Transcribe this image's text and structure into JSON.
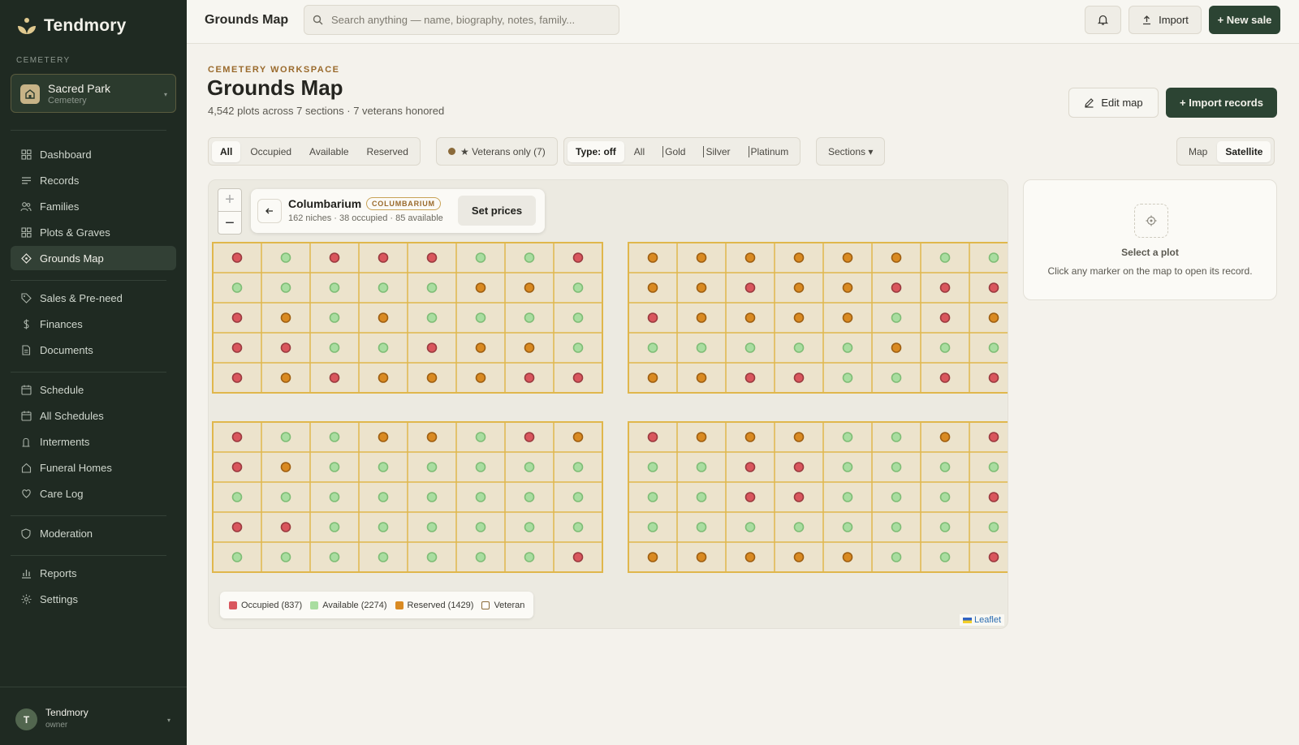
{
  "brand": {
    "name": "Tendmory"
  },
  "sidebar": {
    "section_label": "CEMETERY",
    "cemetery": {
      "name": "Sacred Park",
      "type": "Cemetery"
    },
    "groups": [
      [
        {
          "label": "Dashboard",
          "icon": "grid-icon"
        },
        {
          "label": "Records",
          "icon": "list-icon"
        },
        {
          "label": "Families",
          "icon": "users-icon"
        },
        {
          "label": "Plots & Graves",
          "icon": "grid-icon"
        },
        {
          "label": "Grounds Map",
          "icon": "diamond-icon",
          "active": true
        }
      ],
      [
        {
          "label": "Sales & Pre-need",
          "icon": "tag-icon"
        },
        {
          "label": "Finances",
          "icon": "dollar-icon"
        },
        {
          "label": "Documents",
          "icon": "document-icon"
        }
      ],
      [
        {
          "label": "Schedule",
          "icon": "calendar-icon"
        },
        {
          "label": "All Schedules",
          "icon": "calendar-icon"
        },
        {
          "label": "Interments",
          "icon": "headstone-icon"
        },
        {
          "label": "Funeral Homes",
          "icon": "home-icon"
        },
        {
          "label": "Care Log",
          "icon": "heart-icon"
        }
      ],
      [
        {
          "label": "Moderation",
          "icon": "shield-icon"
        }
      ],
      [
        {
          "label": "Reports",
          "icon": "bar-chart-icon"
        },
        {
          "label": "Settings",
          "icon": "gear-icon"
        }
      ]
    ],
    "user": {
      "initial": "T",
      "name": "Tendmory",
      "role": "owner"
    }
  },
  "topbar": {
    "title": "Grounds Map",
    "search_placeholder": "Search anything — name, biography, notes, family...",
    "import_label": "Import",
    "new_sale_label": "+ New sale"
  },
  "header": {
    "eyebrow": "CEMETERY WORKSPACE",
    "title": "Grounds Map",
    "subtitle": "4,542 plots across 7 sections · 7 veterans honored",
    "edit_map_label": "Edit map",
    "import_records_label": "+ Import records"
  },
  "filters": {
    "status": [
      "All",
      "Occupied",
      "Available",
      "Reserved"
    ],
    "status_selected": "All",
    "veterans_label": "★ Veterans only (7)",
    "type_label": "Type: off",
    "type_options": [
      "All",
      "Gold",
      "Silver",
      "Platinum"
    ],
    "sections_label": "Sections ▾",
    "view": [
      "Map",
      "Satellite"
    ],
    "view_selected": "Satellite"
  },
  "map": {
    "section": {
      "name": "Columbarium",
      "badge": "COLUMBARIUM",
      "meta": "162 niches · 38 occupied · 85 available",
      "set_prices_label": "Set prices"
    },
    "zoom_in": "+",
    "zoom_out": "−",
    "attribution": "Leaflet",
    "legend": [
      {
        "label": "Occupied (837)",
        "color": "#d9565d"
      },
      {
        "label": "Available (2274)",
        "color": "#a9dda0"
      },
      {
        "label": "Reserved (1429)",
        "color": "#d98a22"
      },
      {
        "label": "Veteran",
        "color": "#ffffff"
      }
    ],
    "status_colors": {
      "O": "#d9565d",
      "A": "#a9dda0",
      "R": "#d98a22"
    },
    "blocks": [
      [
        "OAOOOAAO",
        "AAAAARRA",
        "ORARAAAA",
        "OOAAORRA",
        "ORORRROO"
      ],
      [
        "RRRRRRAA",
        "RRORROOO",
        "ORRRRAOR",
        "AAAAARAA",
        "RROOAAOO"
      ],
      [
        "OAARRAOR",
        "ORAAAAAA",
        "AAAAAAAA",
        "OOAAAAAA",
        "AAAAAAAO"
      ],
      [
        "ORRRAARO",
        "AAOOAAAA",
        "AAOOAAAO",
        "AAAAAAAA",
        "RRRRRAAO"
      ]
    ]
  },
  "detail": {
    "title": "Select a plot",
    "hint": "Click any marker on the map to open its record."
  }
}
